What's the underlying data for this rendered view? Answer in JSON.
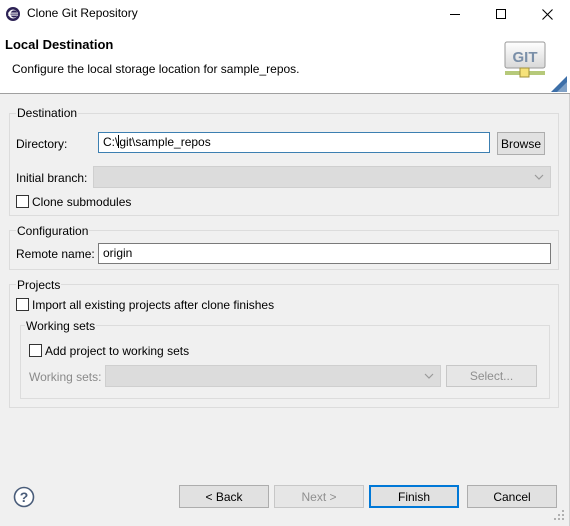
{
  "window": {
    "title": "Clone Git Repository",
    "icons": {
      "app": "eclipse-icon",
      "minimize": "minimize-icon",
      "maximize": "maximize-icon",
      "close": "close-icon"
    }
  },
  "banner": {
    "title": "Local Destination",
    "description": "Configure the local storage location for sample_repos.",
    "logo_text": "GIT"
  },
  "destination": {
    "group_label": "Destination",
    "directory_label": "Directory:",
    "directory_value_prefix": "C:\\",
    "directory_value_suffix": "git\\sample_repos",
    "browse_label": "Browse",
    "initial_branch_label": "Initial branch:",
    "initial_branch_value": "",
    "clone_submodules_label": "Clone submodules",
    "clone_submodules_checked": false
  },
  "configuration": {
    "group_label": "Configuration",
    "remote_name_label": "Remote name:",
    "remote_name_value": "origin"
  },
  "projects": {
    "group_label": "Projects",
    "import_label": "Import all existing projects after clone finishes",
    "import_checked": false,
    "working_sets": {
      "group_label": "Working sets",
      "add_label": "Add project to working sets",
      "add_checked": false,
      "sets_label": "Working sets:",
      "sets_value": "",
      "select_label": "Select..."
    }
  },
  "footer": {
    "back_label": "< Back",
    "next_label": "Next >",
    "finish_label": "Finish",
    "cancel_label": "Cancel"
  },
  "colors": {
    "focus_border": "#3c7fb1",
    "default_button_border": "#0078d7",
    "disabled_text": "#8a8a8a"
  }
}
